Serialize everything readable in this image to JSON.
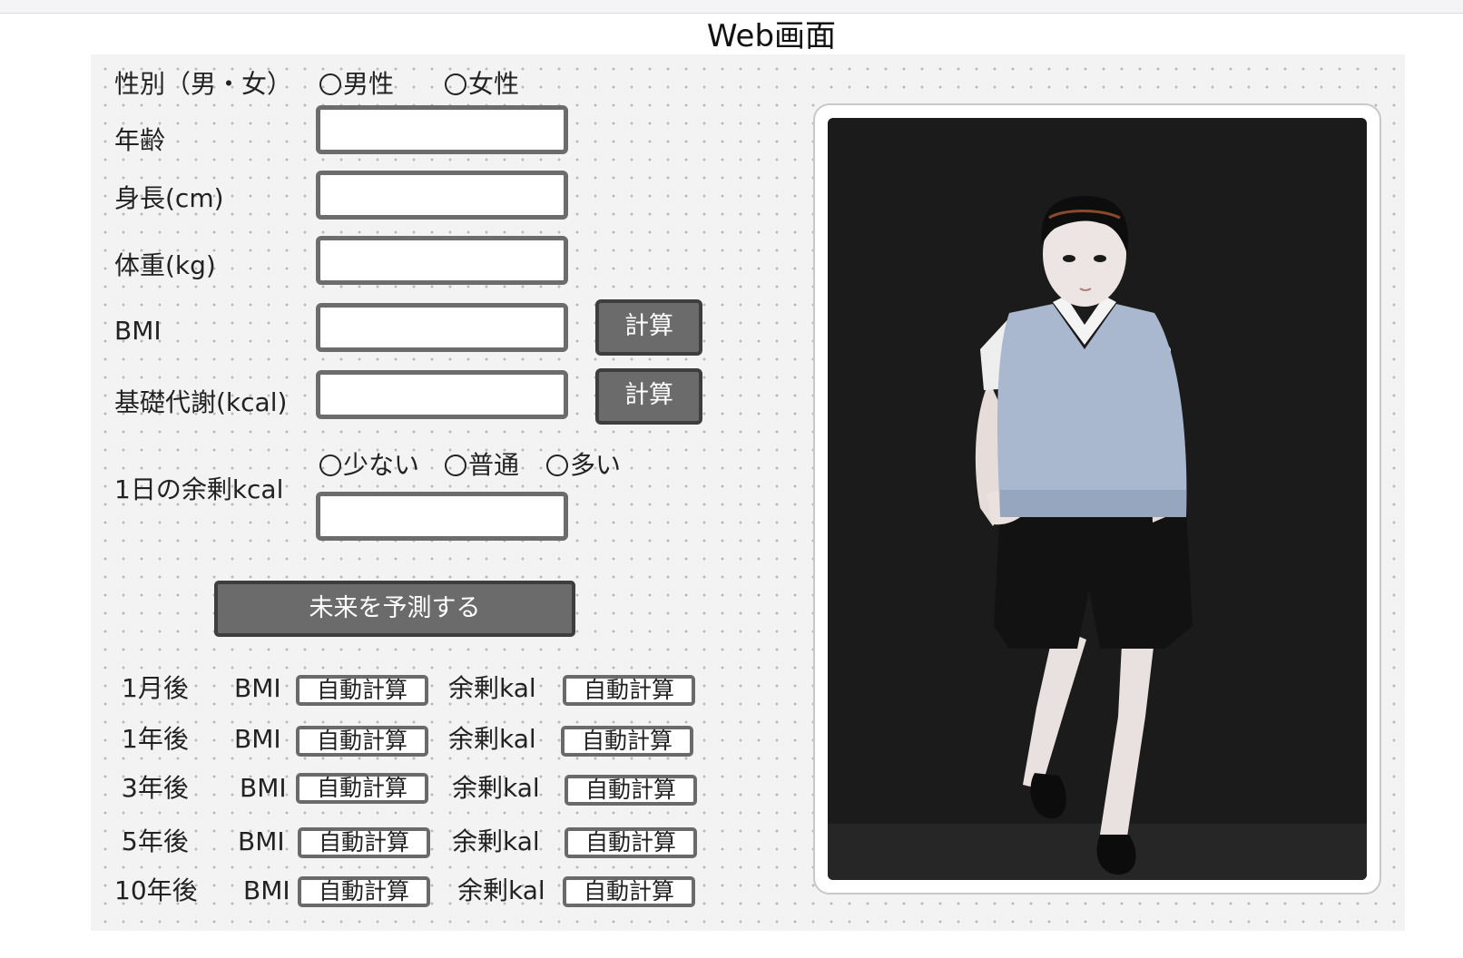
{
  "page": {
    "title": "Web画面"
  },
  "form": {
    "gender": {
      "label": "性別（男・女）",
      "options": [
        "男性",
        "女性"
      ]
    },
    "age": {
      "label": "年齢",
      "value": ""
    },
    "height": {
      "label": "身長(cm)",
      "value": ""
    },
    "weight": {
      "label": "体重(kg)",
      "value": ""
    },
    "bmi": {
      "label": "BMI",
      "value": "",
      "button": "計算"
    },
    "basal": {
      "label": "基礎代謝(kcal)",
      "value": "",
      "button": "計算"
    },
    "surplus": {
      "label": "1日の余剰kcal",
      "options": [
        "少ない",
        "普通",
        "多い"
      ],
      "value": ""
    },
    "predict_button": "未来を予測する"
  },
  "predictions": {
    "rows": [
      {
        "period": "1月後",
        "bmi_label": "BMI",
        "bmi_value": "自動計算",
        "kcal_label": "余剰kal",
        "kcal_value": "自動計算"
      },
      {
        "period": "1年後",
        "bmi_label": "BMI",
        "bmi_value": "自動計算",
        "kcal_label": "余剰kal",
        "kcal_value": "自動計算"
      },
      {
        "period": "3年後",
        "bmi_label": "BMI",
        "bmi_value": "自動計算",
        "kcal_label": "余剰kal",
        "kcal_value": "自動計算"
      },
      {
        "period": "5年後",
        "bmi_label": "BMI",
        "bmi_value": "自動計算",
        "kcal_label": "余剰kal",
        "kcal_value": "自動計算"
      },
      {
        "period": "10年後",
        "bmi_label": "BMI",
        "bmi_value": "自動計算",
        "kcal_label": "余剰kal",
        "kcal_value": "自動計算"
      }
    ]
  },
  "preview": {
    "icon": "character-figure",
    "background": "#1b1b1b"
  }
}
